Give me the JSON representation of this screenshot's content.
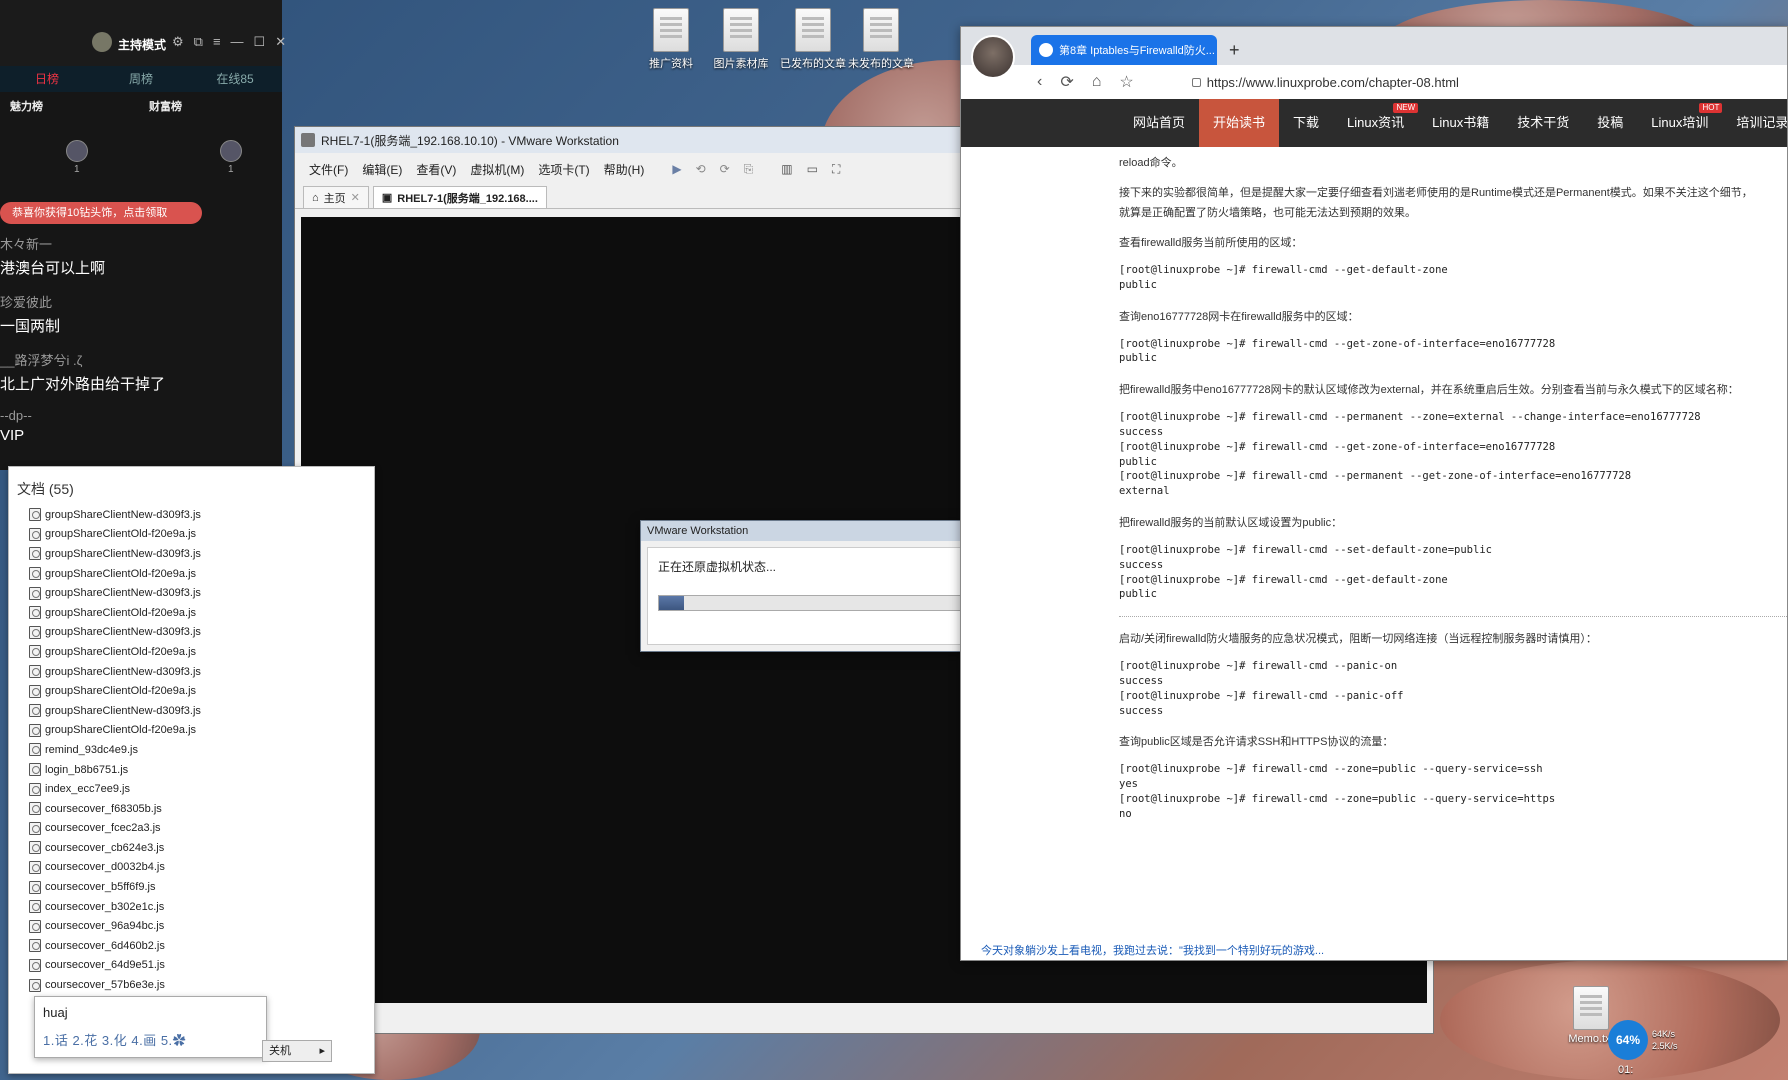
{
  "desktop_icons": [
    {
      "label": "推广资料"
    },
    {
      "label": "图片素材库"
    },
    {
      "label": "已发布的文章"
    },
    {
      "label": "未发布的文章"
    }
  ],
  "desktop_icons_bottom": [
    {
      "label": "Memo.txt"
    }
  ],
  "live_panel": {
    "title": "主持模式",
    "tabs": [
      "日榜",
      "周榜",
      "在线85"
    ],
    "active_tab": "日榜",
    "sub_left": "魅力榜",
    "sub_right": "财富榜",
    "rank_left_count": "1",
    "rank_right_count": "1",
    "gift_banner": "恭喜你获得10钻头饰，点击领取",
    "chat": [
      {
        "user": "木々新一",
        "text": "港澳台可以上啊"
      },
      {
        "user": "珍爱彼此",
        "text": "一国两制"
      },
      {
        "user": "__路浮梦兮i .ζ",
        "text": "北上广对外路由给干掉了"
      },
      {
        "user": "--dp--",
        "text": "VIP"
      }
    ]
  },
  "files_panel": {
    "header": "文档 (55)",
    "files": [
      "groupShareClientNew-d309f3.js",
      "groupShareClientOld-f20e9a.js",
      "groupShareClientNew-d309f3.js",
      "groupShareClientOld-f20e9a.js",
      "groupShareClientNew-d309f3.js",
      "groupShareClientOld-f20e9a.js",
      "groupShareClientNew-d309f3.js",
      "groupShareClientOld-f20e9a.js",
      "groupShareClientNew-d309f3.js",
      "groupShareClientOld-f20e9a.js",
      "groupShareClientNew-d309f3.js",
      "groupShareClientOld-f20e9a.js",
      "remind_93dc4e9.js",
      "login_b8b6751.js",
      "index_ecc7ee9.js",
      "coursecover_f68305b.js",
      "coursecover_fcec2a3.js",
      "coursecover_cb624e3.js",
      "coursecover_d0032b4.js",
      "coursecover_b5ff6f9.js",
      "coursecover_b302e1c.js",
      "coursecover_96a94bc.js",
      "coursecover_6d460b2.js",
      "coursecover_64d9e51.js",
      "coursecover_57b6e3e.js"
    ]
  },
  "ime": {
    "composition": "huaj",
    "candidates": "1.话 2.花 3.化 4.画 5.✿"
  },
  "shutdown_label": "关机",
  "vmware": {
    "title": "RHEL7-1(服务端_192.168.10.10) - VMware Workstation",
    "menu": [
      "文件(F)",
      "编辑(E)",
      "查看(V)",
      "虚拟机(M)",
      "选项卡(T)",
      "帮助(H)"
    ],
    "tabs": [
      {
        "label": "主页"
      },
      {
        "label": "RHEL7-1(服务端_192.168...."
      }
    ],
    "dialog": {
      "title": "VMware Workstation",
      "message": "正在还原虚拟机状态...",
      "progress": 0.08
    }
  },
  "browser": {
    "tab_title": "第8章 Iptables与Firewalld防火...",
    "url": "https://www.linuxprobe.com/chapter-08.html",
    "nav": [
      {
        "label": "网站首页",
        "active": false,
        "tag": ""
      },
      {
        "label": "开始读书",
        "active": true,
        "tag": ""
      },
      {
        "label": "下载",
        "active": false,
        "tag": ""
      },
      {
        "label": "Linux资讯",
        "active": false,
        "tag": "NEW"
      },
      {
        "label": "Linux书籍",
        "active": false,
        "tag": ""
      },
      {
        "label": "技术干货",
        "active": false,
        "tag": ""
      },
      {
        "label": "投稿",
        "active": false,
        "tag": ""
      },
      {
        "label": "Linux培训",
        "active": false,
        "tag": "HOT"
      },
      {
        "label": "培训记录",
        "active": false,
        "tag": ""
      }
    ],
    "article": {
      "p0": "reload命令。",
      "p1": "接下来的实验都很简单，但是提醒大家一定要仔细查看刘遄老师使用的是Runtime模式还是Permanent模式。如果不关注这个细节，就算是正确配置了防火墙策略，也可能无法达到预期的效果。",
      "s1": "查看firewalld服务当前所使用的区域：",
      "c1": "[root@linuxprobe ~]# firewall-cmd --get-default-zone\npublic",
      "s2": "查询eno16777728网卡在firewalld服务中的区域：",
      "c2": "[root@linuxprobe ~]# firewall-cmd --get-zone-of-interface=eno16777728\npublic",
      "s3": "把firewalld服务中eno16777728网卡的默认区域修改为external，并在系统重启后生效。分别查看当前与永久模式下的区域名称：",
      "c3": "[root@linuxprobe ~]# firewall-cmd --permanent --zone=external --change-interface=eno16777728\nsuccess\n[root@linuxprobe ~]# firewall-cmd --get-zone-of-interface=eno16777728\npublic\n[root@linuxprobe ~]# firewall-cmd --permanent --get-zone-of-interface=eno16777728\nexternal",
      "s4": "把firewalld服务的当前默认区域设置为public：",
      "c4": "[root@linuxprobe ~]# firewall-cmd --set-default-zone=public\nsuccess\n[root@linuxprobe ~]# firewall-cmd --get-default-zone\npublic",
      "s5": "启动/关闭firewalld防火墙服务的应急状况模式，阻断一切网络连接（当远程控制服务器时请慎用）：",
      "c5": "[root@linuxprobe ~]# firewall-cmd --panic-on\nsuccess\n[root@linuxprobe ~]# firewall-cmd --panic-off\nsuccess",
      "s6": "查询public区域是否允许请求SSH和HTTPS协议的流量：",
      "c6": "[root@linuxprobe ~]# firewall-cmd --zone=public --query-service=ssh\nyes\n[root@linuxprobe ~]# firewall-cmd --zone=public --query-service=https\nno"
    },
    "footer_link": "今天对象躺沙发上看电视，我跑过去说：\"我找到一个特别好玩的游戏..."
  },
  "tray": {
    "cpu": "64%",
    "up": "64K/s",
    "down": "2.5K/s",
    "clock": "01:"
  }
}
